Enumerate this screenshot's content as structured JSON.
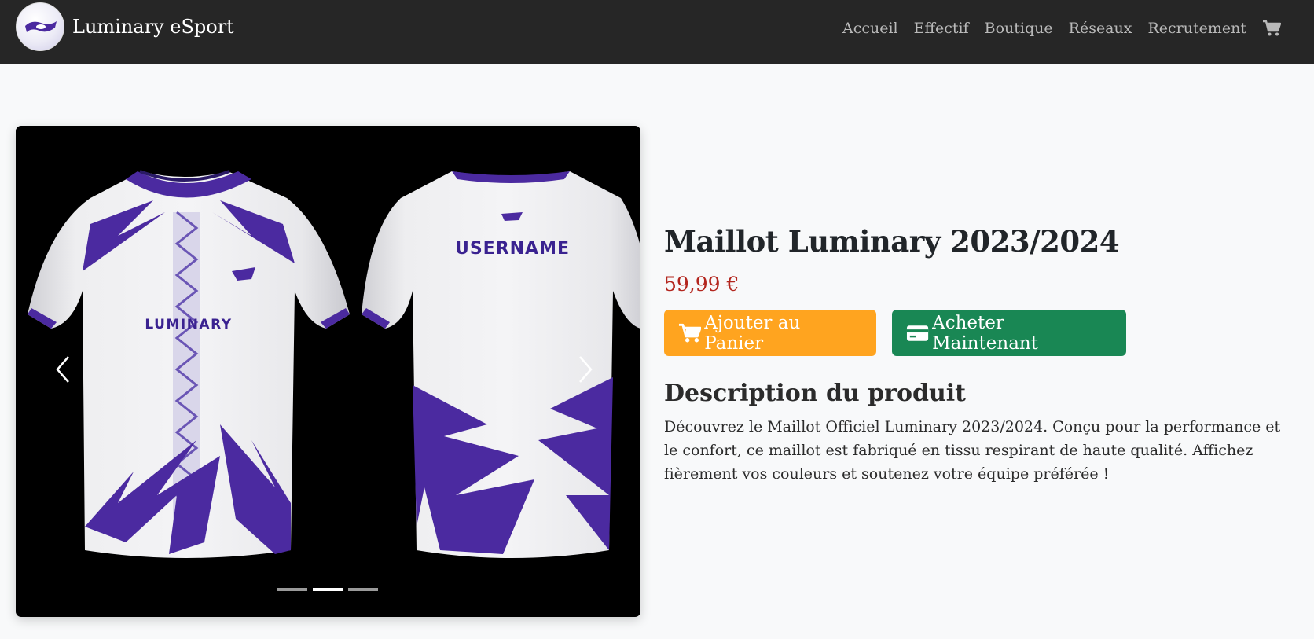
{
  "navbar": {
    "brand": "Luminary eSport",
    "links": [
      "Accueil",
      "Effectif",
      "Boutique",
      "Réseaux",
      "Recrutement"
    ],
    "cart_icon": "cart-icon"
  },
  "carousel": {
    "front_print": "LUMINARY",
    "back_print": "USERNAME",
    "slides_count": 3,
    "active_slide": 2
  },
  "product": {
    "title": "Maillot Luminary 2023/2024",
    "price": "59,99 €",
    "add_to_cart": "Ajouter au Panier",
    "buy_now": "Acheter Maintenant",
    "description_title": "Description du produit",
    "description": "Découvrez le Maillot Officiel Luminary 2023/2024. Conçu pour la performance et le confort, ce maillot est fabriqué en tissu respirant de haute qualité. Affichez fièrement vos couleurs et soutenez votre équipe préférée !"
  },
  "colors": {
    "navbar_bg": "#262626",
    "cart_button": "#ffa41f",
    "buy_button": "#198754",
    "price": "#b3261e",
    "jersey_accent": "#4b2aa0"
  }
}
